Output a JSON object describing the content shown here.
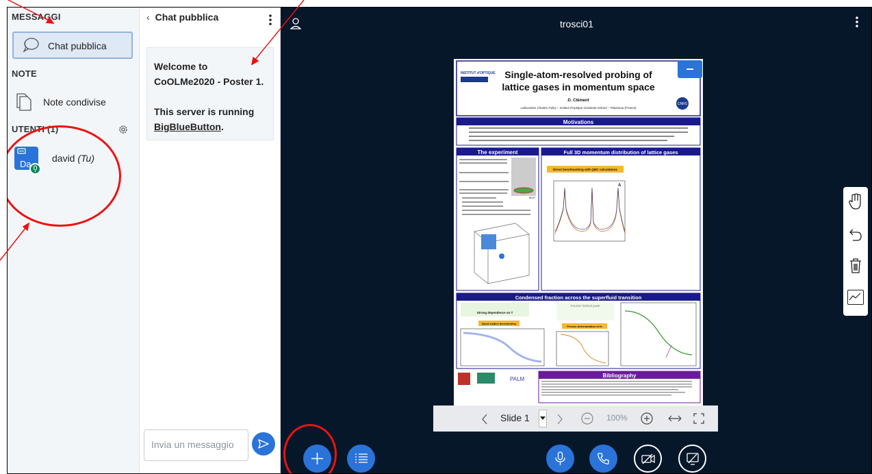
{
  "sidebar": {
    "messages_label": "MESSAGGI",
    "public_chat_label": "Chat pubblica",
    "notes_label": "NOTE",
    "shared_notes_label": "Note condivise",
    "users_label": "UTENTI (1)",
    "users": [
      {
        "initials": "Da",
        "name": "david",
        "suffix": "(Tu)"
      }
    ]
  },
  "chat": {
    "back_title": "Chat pubblica",
    "welcome_line1": "Welcome to CoOLMe2020 - Poster 1.",
    "welcome_line2_prefix": "This server is running",
    "welcome_link": "BigBlueButton",
    "welcome_line2_suffix": ".",
    "input_placeholder": "Invia un messaggio"
  },
  "main": {
    "room_name": "trosci01",
    "slide_label": "Slide 1",
    "zoom": "100%"
  },
  "poster": {
    "title_line1": "Single-atom-resolved probing of",
    "title_line2": "lattice gases in momentum space",
    "author": "D. Clément",
    "affiliation": "Laboratoire Charles Fabry – Institut d'Optique Graduate School – Palaiseau (France)",
    "sec_motivations": "Motivations",
    "sec_experiment": "The experiment",
    "sec_distribution": "Full 3D momentum distribution of lattice gases",
    "sec_condensed": "Condensed fraction across the superfluid transition",
    "sec_bibliography": "Bibliography",
    "qmc_badge": "Direct benchmarking with QMC calculations",
    "lattice_badge": "Novel Lattice thermometry",
    "precise_badge": "Precise determination of fc",
    "fourier_text": "Fourier limited peak",
    "strong_text": "Strong dependence on T",
    "palm_text": "PALM",
    "cnrs_text": "CNRS",
    "institut_text": "INSTITUT d'OPTIQUE",
    "mcp_text": "MCP",
    "panel_a": "A"
  },
  "colors": {
    "accent": "#2a73d9",
    "dark_bg": "#06172a",
    "poster_navy": "#1a1a8c",
    "poster_purple": "#6a1b9a",
    "annotation_red": "#ee1111"
  }
}
